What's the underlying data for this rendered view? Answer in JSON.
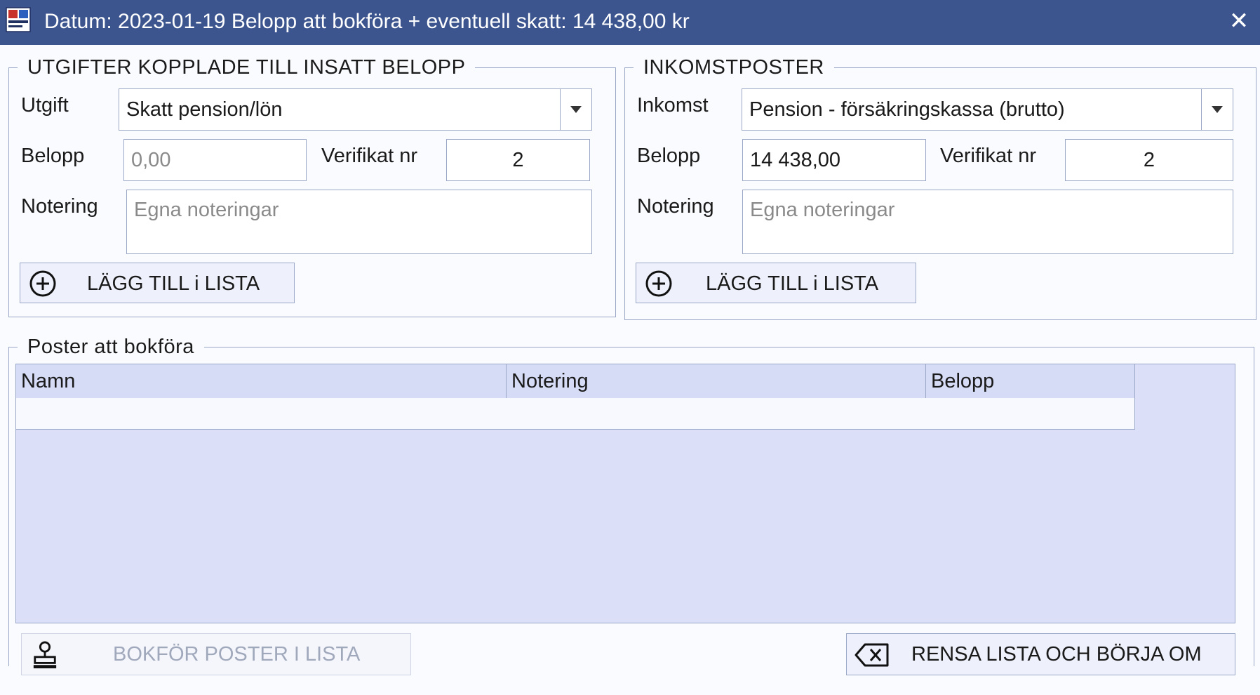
{
  "window": {
    "title": "Datum: 2023-01-19 Belopp att bokföra + eventuell skatt: 14 438,00 kr",
    "close_glyph": "✕",
    "titlebar_color": "#3c558f",
    "app_icon": "app-logo-icon"
  },
  "expenses": {
    "legend": "UTGIFTER KOPPLADE TILL INSATT BELOPP",
    "type_label": "Utgift",
    "type_value": "Skatt pension/lön",
    "amount_label": "Belopp",
    "amount_placeholder": "0,00",
    "voucher_label": "Verifikat nr",
    "voucher_value": "2",
    "note_label": "Notering",
    "note_placeholder": "Egna noteringar",
    "add_button": "LÄGG TILL i LISTA",
    "add_icon": "plus-circle-icon"
  },
  "income": {
    "legend": "INKOMSTPOSTER",
    "type_label": "Inkomst",
    "type_value": "Pension - försäkringskassa (brutto)",
    "amount_label": "Belopp",
    "amount_value": "14 438,00",
    "voucher_label": "Verifikat nr",
    "voucher_value": "2",
    "note_label": "Notering",
    "note_placeholder": "Egna noteringar",
    "add_button": "LÄGG TILL i LISTA",
    "add_icon": "plus-circle-icon"
  },
  "posts": {
    "legend": "Poster att bokföra",
    "columns": [
      "Namn",
      "Notering",
      "Belopp"
    ],
    "rows": [],
    "grid_color": "#dbe0f8"
  },
  "footer": {
    "book_button": "BOKFÖR POSTER I LISTA",
    "book_icon": "stamp-icon",
    "book_enabled": false,
    "clear_button": "RENSA LISTA OCH BÖRJA OM",
    "clear_icon": "backspace-x-icon"
  }
}
